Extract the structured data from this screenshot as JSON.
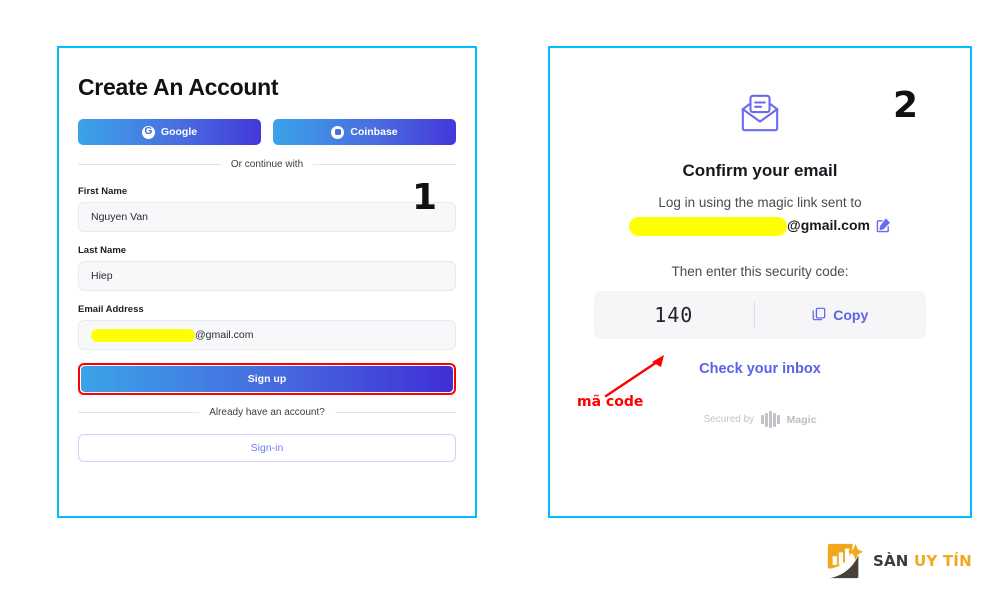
{
  "theme": {
    "panel_border": "#00bfff",
    "accent_blue": "#4a6ee0",
    "accent_purple": "#5a62e8",
    "annotation_red": "#ff0000",
    "redaction_yellow": "#ffff00",
    "logo_orange": "#f0a81e"
  },
  "steps": {
    "one": "1",
    "two": "2"
  },
  "signup_panel": {
    "title": "Create An Account",
    "oauth": [
      {
        "label": "Google",
        "icon": "google-icon",
        "glyph": "G"
      },
      {
        "label": "Coinbase",
        "icon": "coinbase-icon",
        "glyph": ""
      }
    ],
    "divider_label": "Or continue with",
    "fields": [
      {
        "label": "First Name",
        "value": "Nguyen Van",
        "redacted": false
      },
      {
        "label": "Last Name",
        "value": "Hiep",
        "redacted": false
      },
      {
        "label": "Email Address",
        "value": "@gmail.com",
        "redacted": true
      }
    ],
    "submit_label": "Sign up",
    "footer_divider_label": "Already have an account?",
    "signin_label": "Sign-in"
  },
  "confirm_panel": {
    "icon": "open-envelope-icon",
    "title": "Confirm your email",
    "subtitle": "Log in using the magic link sent to",
    "email_suffix": "@gmail.com",
    "edit_icon": "edit-pencil-icon",
    "then_enter_label": "Then enter this security code:",
    "security_code": "140",
    "copy_label": "Copy",
    "copy_icon": "copy-icon",
    "inbox_link_label": "Check your inbox",
    "secured_by_label": "Secured by",
    "secured_brand": "Magic"
  },
  "annotation": {
    "ma_code_label": "mã code",
    "arrow": "red-arrow-pointing-to-code"
  },
  "watermark": {
    "logo_icon": "bar-chart-logo-icon",
    "text_primary": "SÀN",
    "text_accent": "UY TÍN"
  }
}
